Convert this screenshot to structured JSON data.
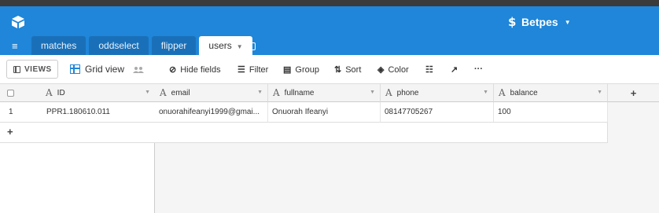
{
  "header": {
    "base_title": "Betpes",
    "colors": {
      "header_bg": "#1f86d9",
      "tab_bg": "#1a70b8"
    }
  },
  "tabs": [
    {
      "label": "matches",
      "active": false
    },
    {
      "label": "oddselect",
      "active": false
    },
    {
      "label": "flipper",
      "active": false
    },
    {
      "label": "users",
      "active": true
    }
  ],
  "toolbar": {
    "views_label": "VIEWS",
    "view_name": "Grid view",
    "hide_fields": "Hide fields",
    "filter": "Filter",
    "group": "Group",
    "sort": "Sort",
    "color": "Color",
    "more": "···"
  },
  "table": {
    "columns": [
      "ID",
      "email",
      "fullname",
      "phone",
      "balance"
    ],
    "rows": [
      {
        "row_number": "1",
        "ID": "PPR1.180610.011",
        "email": "onuorahifeanyi1999@gmai...",
        "fullname": "Onuorah Ifeanyi",
        "phone": "08147705267",
        "balance": "100"
      }
    ],
    "add_row_label": "+",
    "add_column_label": "+"
  }
}
